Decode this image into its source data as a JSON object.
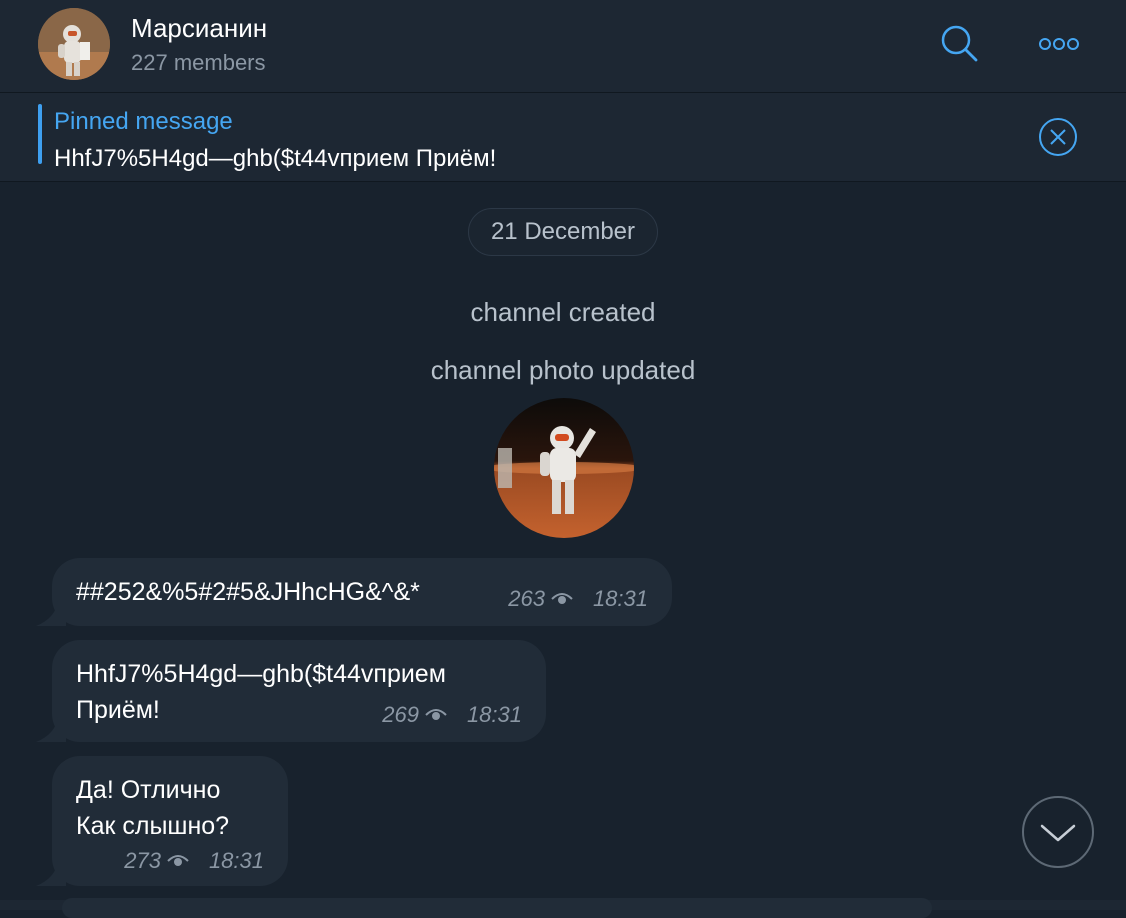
{
  "header": {
    "title": "Марсианин",
    "subtitle": "227 members",
    "avatar_icon": "astronaut-avatar-icon",
    "search_icon": "search-icon",
    "more_icon": "more-options-icon"
  },
  "pinned": {
    "label": "Pinned message",
    "text": "HhfJ7%5H4gd—ghb($t44vприем Приём!",
    "close_icon": "close-circle-icon"
  },
  "chat": {
    "date": "21 December",
    "service": [
      "channel created",
      "channel photo updated"
    ],
    "messages": [
      {
        "text": "##252&%5#2#5&JHhcHG&^&*",
        "views": "263",
        "time": "18:31"
      },
      {
        "text": "HhfJ7%5H4gd—ghb($t44vприем\nПриём!",
        "views": "269",
        "time": "18:31"
      },
      {
        "text": "Да! Отлично\nКак слышно?",
        "views": "273",
        "time": "18:31"
      }
    ],
    "view_icon": "eye-icon",
    "scroll_icon": "chevron-down-icon"
  },
  "colors": {
    "background": "#18222d",
    "header": "#1d2733",
    "bubble": "#212c38",
    "accent": "#45a6f2",
    "muted": "#8b97a4"
  }
}
